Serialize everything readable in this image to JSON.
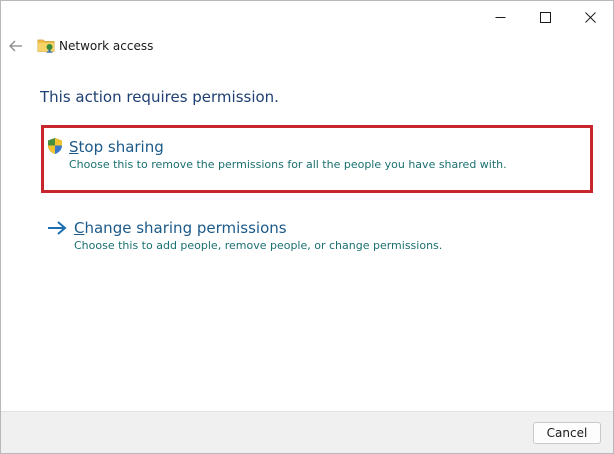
{
  "window": {
    "title": "Network access",
    "controls": {
      "minimize": "minimize-icon",
      "maximize": "maximize-icon",
      "close": "close-icon"
    },
    "back_icon": "back-arrow-icon",
    "title_icon": "network-folder-icon"
  },
  "main": {
    "heading": "This action requires permission.",
    "options": [
      {
        "icon": "uac-shield-icon",
        "title_first_letter": "S",
        "title_rest": "top sharing",
        "description": "Choose this to remove the permissions for all the people you have shared with.",
        "highlighted": true
      },
      {
        "icon": "arrow-right-icon",
        "title_first_letter": "C",
        "title_rest": "hange sharing permissions",
        "description": "Choose this to add people, remove people, or change permissions.",
        "highlighted": false
      }
    ]
  },
  "footer": {
    "cancel_label": "Cancel"
  },
  "colors": {
    "highlight_border": "#c7262d",
    "heading": "#1e3f73",
    "option_title": "#1c5a8a",
    "option_description": "#1a7070",
    "footer_bg": "#f0f0f0"
  }
}
